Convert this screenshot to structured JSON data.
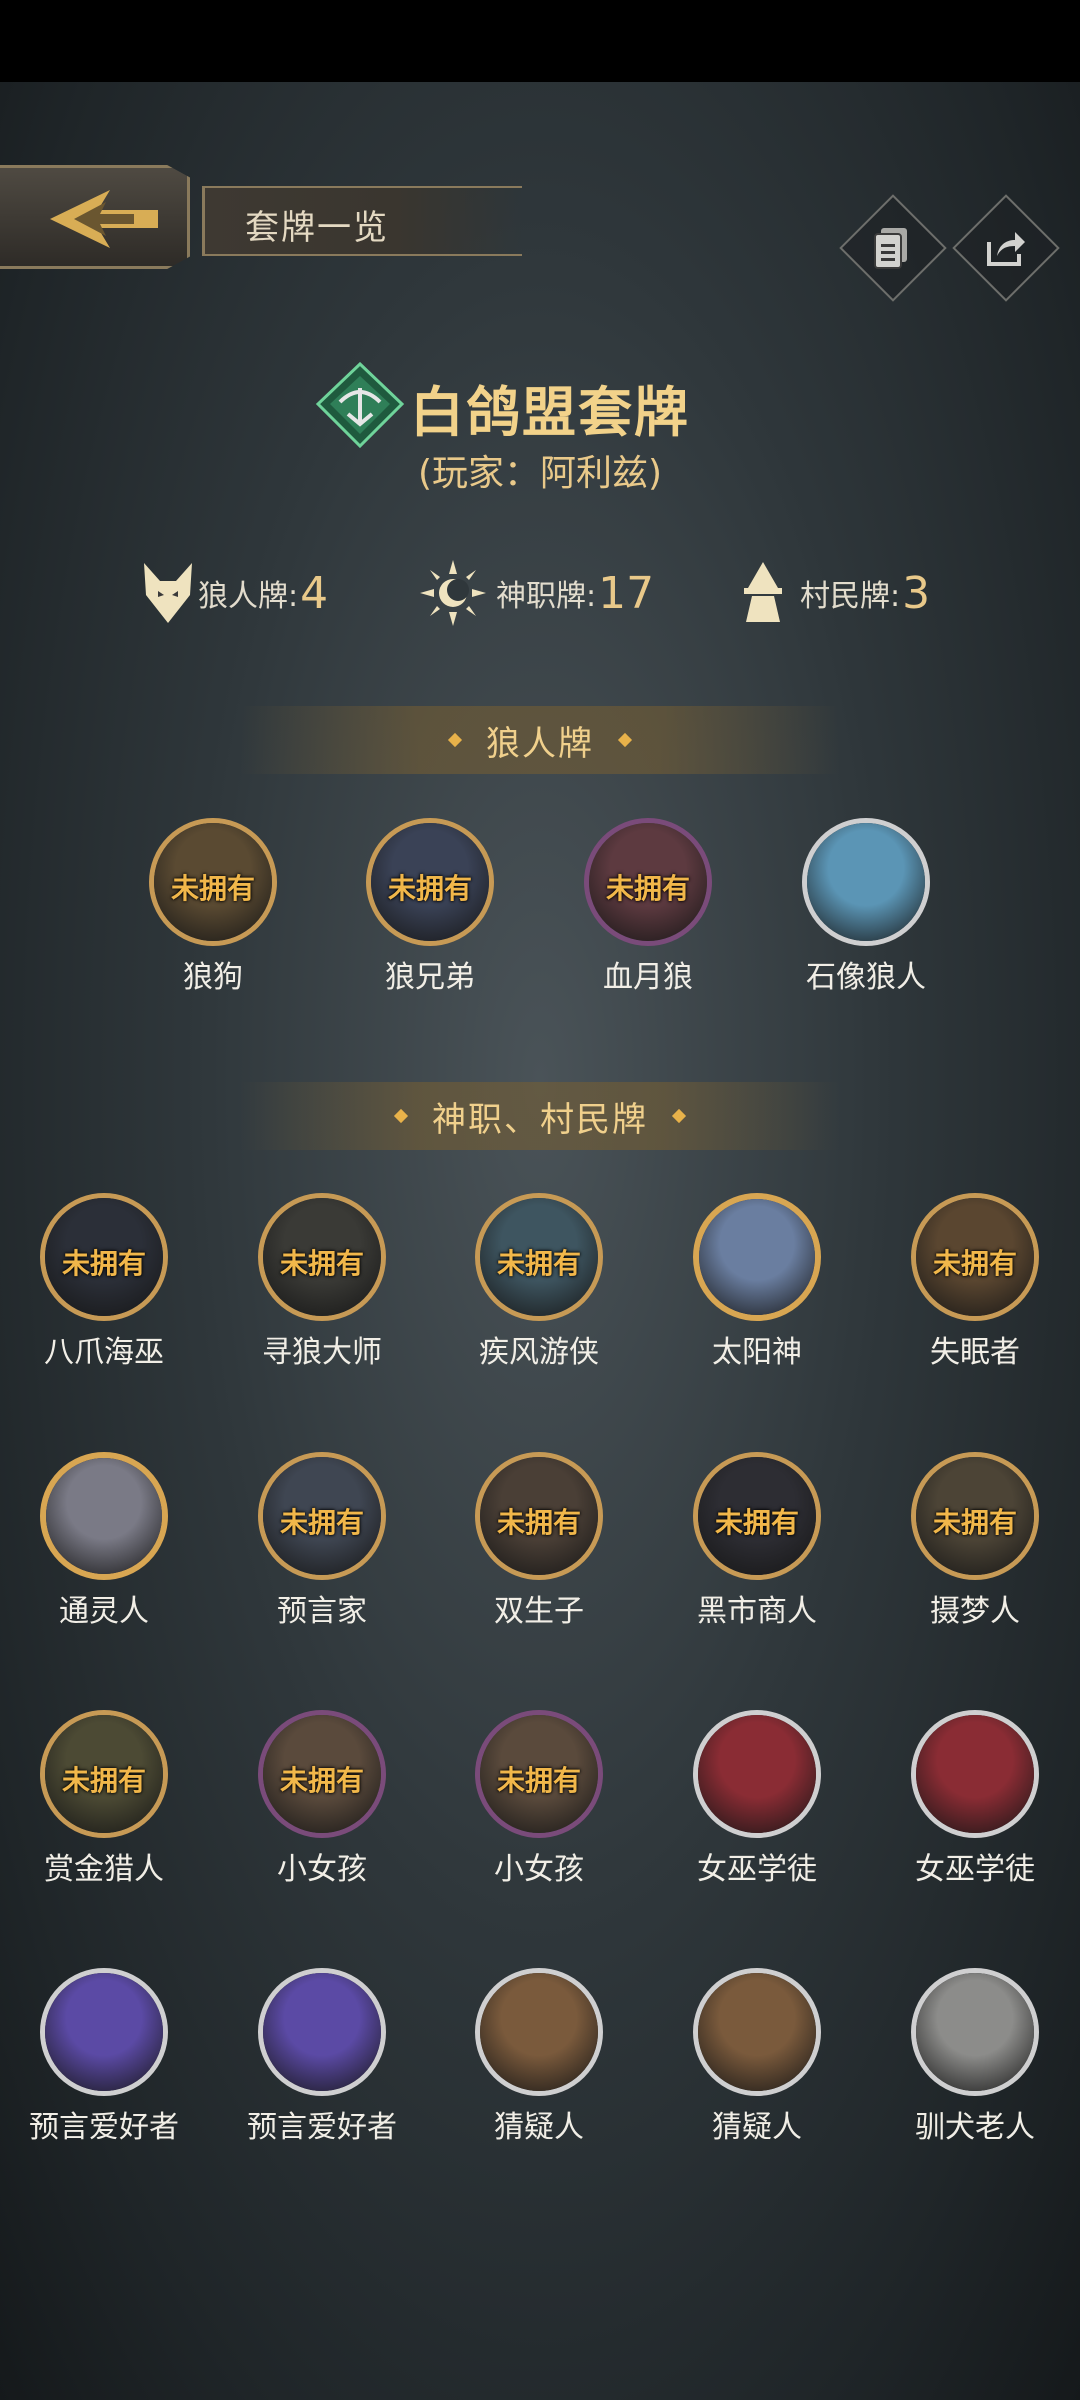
{
  "header": {
    "title": "套牌一览"
  },
  "deck": {
    "name": "白鸽盟套牌",
    "owner_line": "(玩家：阿利兹)"
  },
  "counts": [
    {
      "icon": "wolf-icon",
      "label": "狼人牌:",
      "value": "4"
    },
    {
      "icon": "sun-icon",
      "label": "神职牌:",
      "value": "17"
    },
    {
      "icon": "villager-icon",
      "label": "村民牌:",
      "value": "3"
    }
  ],
  "sections": {
    "werewolf": "狼人牌",
    "god_villager": "神职、村民牌"
  },
  "unowned_label": "未拥有",
  "werewolf_cards": [
    {
      "name": "狼狗",
      "owned": false,
      "frame": "gold",
      "color": "#5a4a32"
    },
    {
      "name": "狼兄弟",
      "owned": false,
      "frame": "gold",
      "color": "#3a4256"
    },
    {
      "name": "血月狼",
      "owned": false,
      "frame": "purple",
      "color": "#5d3a40"
    },
    {
      "name": "石像狼人",
      "owned": true,
      "frame": "silver",
      "color": "#5b95b5"
    }
  ],
  "god_cards": [
    {
      "name": "八爪海巫",
      "owned": false,
      "frame": "gold",
      "color": "#2b2f38"
    },
    {
      "name": "寻狼大师",
      "owned": false,
      "frame": "gold",
      "color": "#3a3a36"
    },
    {
      "name": "疾风游侠",
      "owned": false,
      "frame": "gold",
      "color": "#3e5560"
    },
    {
      "name": "太阳神",
      "owned": true,
      "frame": "brightgold",
      "color": "#6a7ea0"
    },
    {
      "name": "失眠者",
      "owned": false,
      "frame": "gold",
      "color": "#5a4630"
    },
    {
      "name": "通灵人",
      "owned": true,
      "frame": "brightgold",
      "color": "#7a7a86"
    },
    {
      "name": "预言家",
      "owned": false,
      "frame": "gold",
      "color": "#3f4652"
    },
    {
      "name": "双生子",
      "owned": false,
      "frame": "gold",
      "color": "#4a3f36"
    },
    {
      "name": "黑市商人",
      "owned": false,
      "frame": "gold",
      "color": "#2d2d33"
    },
    {
      "name": "摄梦人",
      "owned": false,
      "frame": "gold",
      "color": "#4c4436"
    },
    {
      "name": "赏金猎人",
      "owned": false,
      "frame": "gold",
      "color": "#4c4a34"
    },
    {
      "name": "小女孩",
      "owned": false,
      "frame": "purple",
      "color": "#5a4a3c"
    },
    {
      "name": "小女孩",
      "owned": false,
      "frame": "purple",
      "color": "#5a4a3c"
    },
    {
      "name": "女巫学徒",
      "owned": true,
      "frame": "silver",
      "color": "#8a2c34"
    },
    {
      "name": "女巫学徒",
      "owned": true,
      "frame": "silver",
      "color": "#8a2c34"
    },
    {
      "name": "预言爱好者",
      "owned": true,
      "frame": "silver",
      "color": "#5b4aa5"
    },
    {
      "name": "预言爱好者",
      "owned": true,
      "frame": "silver",
      "color": "#5b4aa5"
    },
    {
      "name": "猜疑人",
      "owned": true,
      "frame": "silver",
      "color": "#7a5a3c"
    },
    {
      "name": "猜疑人",
      "owned": true,
      "frame": "silver",
      "color": "#7a5a3c"
    },
    {
      "name": "驯犬老人",
      "owned": true,
      "frame": "silver",
      "color": "#8c8c8a"
    }
  ]
}
